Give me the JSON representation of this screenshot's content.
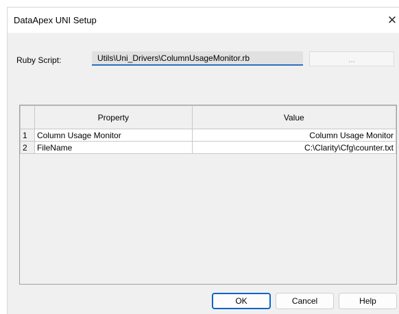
{
  "window": {
    "title": "DataApex UNI Setup",
    "close_symbol": "✕"
  },
  "ruby": {
    "label": "Ruby Script:",
    "value": "Utils\\Uni_Drivers\\ColumnUsageMonitor.rb",
    "browse_label": "..."
  },
  "table": {
    "headers": [
      "",
      "Property",
      "Value"
    ],
    "rows": [
      {
        "num": "1",
        "property": "Column Usage Monitor",
        "value": "Column Usage Monitor"
      },
      {
        "num": "2",
        "property": "FileName",
        "value": "C:\\Clarity\\Cfg\\counter.txt"
      }
    ]
  },
  "buttons": {
    "ok": "OK",
    "cancel": "Cancel",
    "help": "Help"
  }
}
